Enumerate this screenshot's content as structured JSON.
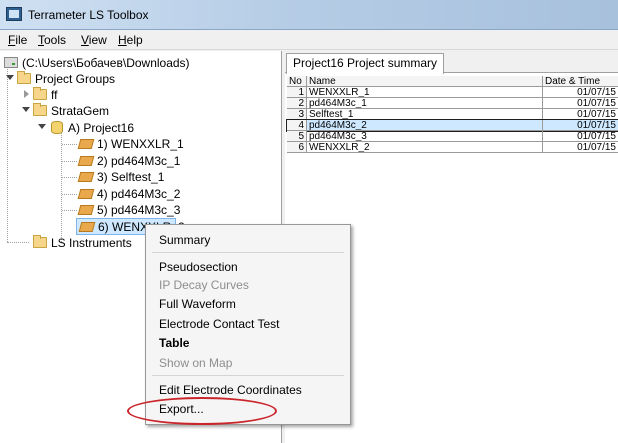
{
  "window": {
    "title": "Terrameter LS Toolbox"
  },
  "menubar": [
    {
      "accel": "F",
      "rest": "ile"
    },
    {
      "accel": "T",
      "rest": "ools"
    },
    {
      "accel": "V",
      "rest": "iew"
    },
    {
      "accel": "H",
      "rest": "elp"
    }
  ],
  "tree": {
    "root": "(C:\\Users\\Бобачев\\Downloads)",
    "project_groups": "Project Groups",
    "ff": "ff",
    "strata_gem": "StrataGem",
    "project": "A) Project16",
    "items": [
      "1) WENXXLR_1",
      "2) pd464M3c_1",
      "3) Selftest_1",
      "4) pd464M3c_2",
      "5) pd464M3c_3",
      "6) WENXXLR_2"
    ],
    "instruments": "LS Instruments"
  },
  "summary": {
    "tab_label": "Project16 Project summary",
    "columns": [
      "No",
      "Name",
      "Date & Time"
    ],
    "rows": [
      {
        "no": "1",
        "name": "WENXXLR_1",
        "date": "01/07/15"
      },
      {
        "no": "2",
        "name": "pd464M3c_1",
        "date": "01/07/15"
      },
      {
        "no": "3",
        "name": "Selftest_1",
        "date": "01/07/15"
      },
      {
        "no": "4",
        "name": "pd464M3c_2",
        "date": "01/07/15"
      },
      {
        "no": "5",
        "name": "pd464M3c_3",
        "date": "01/07/15"
      },
      {
        "no": "6",
        "name": "WENXXLR_2",
        "date": "01/07/15"
      }
    ],
    "selected_row": 4
  },
  "context_menu": {
    "items": [
      {
        "label": "Summary",
        "state": "enabled"
      },
      {
        "label": "Pseudosection",
        "state": "enabled"
      },
      {
        "label": "IP Decay Curves",
        "state": "disabled"
      },
      {
        "label": "Full Waveform",
        "state": "enabled"
      },
      {
        "label": "Electrode Contact Test",
        "state": "enabled"
      },
      {
        "label": "Table",
        "state": "bold"
      },
      {
        "label": "Show on Map",
        "state": "disabled"
      },
      {
        "label": "Edit Electrode Coordinates",
        "state": "enabled"
      },
      {
        "label": "Export...",
        "state": "enabled"
      }
    ]
  },
  "colors": {
    "highlight_ellipse": "#c9262b",
    "selection": "#cde8ff"
  }
}
